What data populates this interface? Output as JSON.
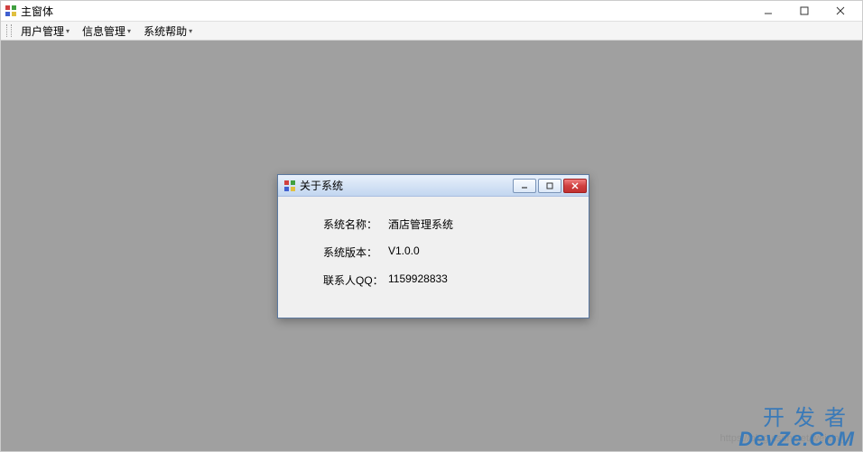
{
  "main_window": {
    "title": "主窗体",
    "controls": {
      "minimize": "minimize",
      "maximize": "maximize",
      "close": "close"
    }
  },
  "menubar": {
    "items": [
      {
        "label": "用户管理"
      },
      {
        "label": "信息管理"
      },
      {
        "label": "系统帮助"
      }
    ]
  },
  "dialog": {
    "title": "关于系统",
    "rows": [
      {
        "label": "系统名称：",
        "value": "酒店管理系统"
      },
      {
        "label": "系统版本：",
        "value": "V1.0.0"
      },
      {
        "label": "联系人QQ：",
        "value": "1159928833"
      }
    ]
  },
  "watermark": {
    "line1": "开发者",
    "line2": "DevZe.CoM",
    "faint_url": "https://blog.csdn.net/weixin_..."
  }
}
